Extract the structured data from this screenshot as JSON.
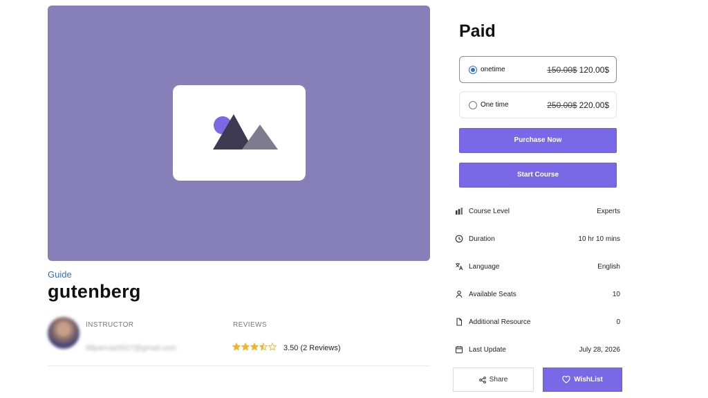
{
  "course": {
    "category": "Guide",
    "title": "gutenberg",
    "instructor_label": "INSTRUCTOR",
    "instructor_email": "lililparvaz0027@gmail.com",
    "reviews_label": "REVIEWS",
    "rating": 3.5,
    "rating_max": 5,
    "reviews_text": "3.50 (2 Reviews)"
  },
  "pricing": {
    "heading": "Paid",
    "plans": [
      {
        "name": "onetime",
        "old_price": "150.00$",
        "price": "120.00$",
        "selected": true
      },
      {
        "name": "One time",
        "old_price": "250.00$",
        "price": "220.00$",
        "selected": false
      }
    ],
    "purchase_label": "Purchase Now",
    "start_label": "Start Course"
  },
  "details": [
    {
      "icon": "bar-chart-icon",
      "label": "Course Level",
      "value": "Experts"
    },
    {
      "icon": "clock-icon",
      "label": "Duration",
      "value": "10 hr 10 mins"
    },
    {
      "icon": "translate-icon",
      "label": "Language",
      "value": "English"
    },
    {
      "icon": "user-icon",
      "label": "Available Seats",
      "value": "10"
    },
    {
      "icon": "file-icon",
      "label": "Additional Resource",
      "value": "0"
    },
    {
      "icon": "calendar-icon",
      "label": "Last Update",
      "value": "July 28, 2026"
    }
  ],
  "actions": {
    "share_label": "Share",
    "wishlist_label": "WishList"
  },
  "colors": {
    "hero_bg": "#877fb7",
    "accent": "#7a69e6",
    "link": "#2d6fbf",
    "star": "#f0b429"
  }
}
